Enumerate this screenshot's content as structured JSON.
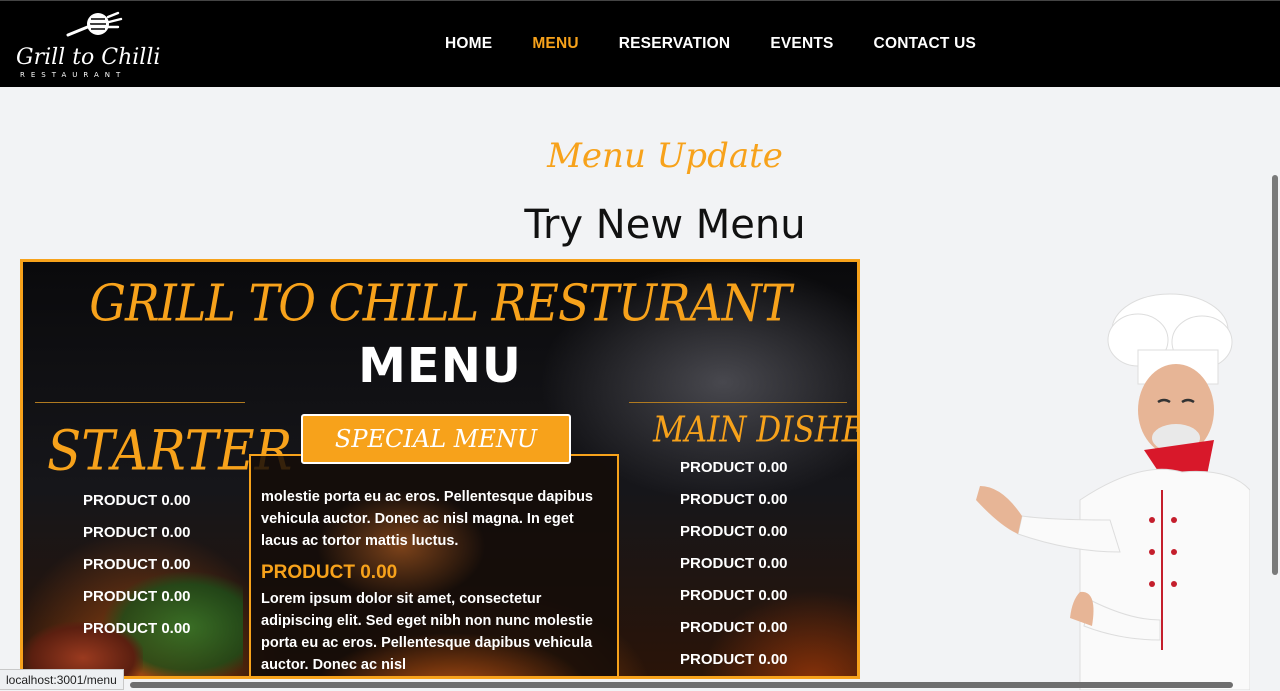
{
  "brand": {
    "name": "Grill to Chilli",
    "tagline": "RESTAURANT"
  },
  "nav": {
    "items": [
      {
        "label": "HOME",
        "active": false
      },
      {
        "label": "MENU",
        "active": true
      },
      {
        "label": "RESERVATION",
        "active": false
      },
      {
        "label": "EVENTS",
        "active": false
      },
      {
        "label": "CONTACT US",
        "active": false
      }
    ]
  },
  "hero": {
    "eyebrow": "Menu Update",
    "title": "Try New Menu"
  },
  "board": {
    "title": "GRILL TO CHILL RESTURANT",
    "subtitle": "MENU",
    "starter": {
      "heading": "STARTER",
      "items": [
        "PRODUCT 0.00",
        "PRODUCT 0.00",
        "PRODUCT 0.00",
        "PRODUCT 0.00",
        "PRODUCT 0.00"
      ]
    },
    "special": {
      "button_label": "SPECIAL MENU",
      "text_top": "molestie porta eu ac eros. Pellentesque dapibus vehicula auctor. Donec ac nisl magna. In eget lacus ac tortor mattis luctus.",
      "price": "PRODUCT 0.00",
      "text_bottom": "Lorem ipsum dolor sit amet, consectetur adipiscing elit. Sed eget nibh non nunc molestie porta eu ac eros. Pellentesque dapibus vehicula auctor. Donec ac nisl"
    },
    "main": {
      "heading": "MAIN DISHES",
      "items": [
        "PRODUCT 0.00",
        "PRODUCT 0.00",
        "PRODUCT 0.00",
        "PRODUCT 0.00",
        "PRODUCT 0.00",
        "PRODUCT 0.00",
        "PRODUCT 0.00"
      ]
    }
  },
  "statusbar": {
    "url": "localhost:3001/menu"
  },
  "colors": {
    "accent": "#f7a21b",
    "navbar": "#000000",
    "page": "#f2f3f5"
  }
}
